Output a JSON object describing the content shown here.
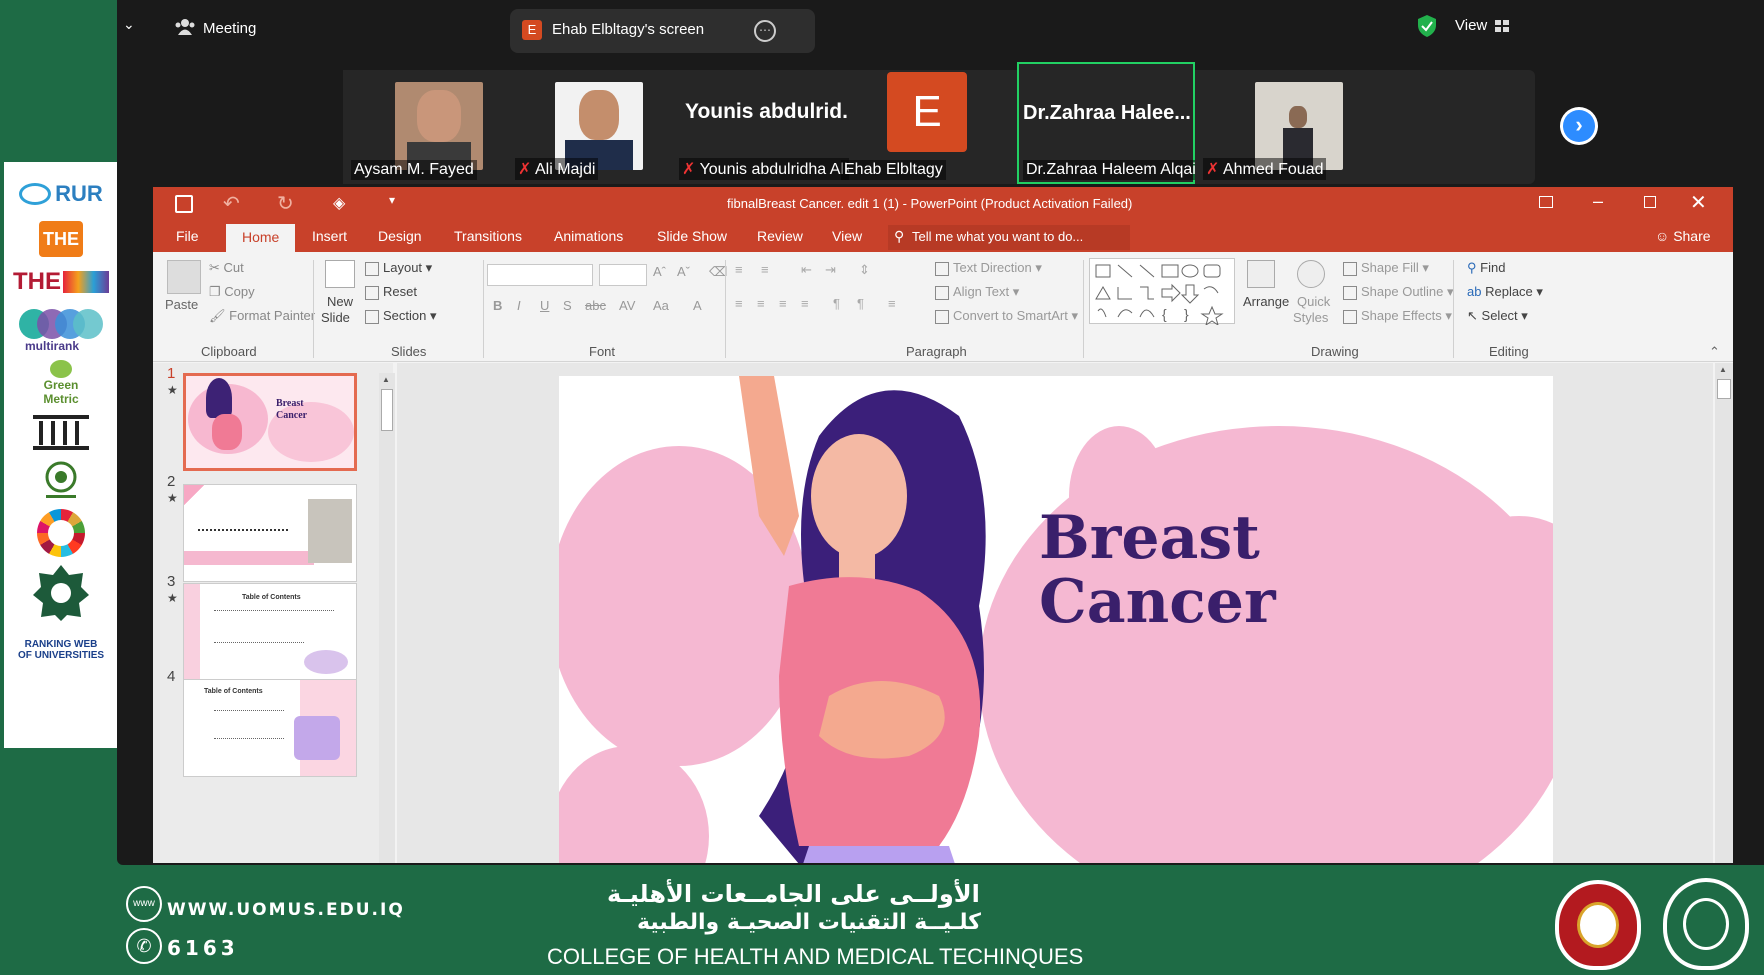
{
  "zoom": {
    "meeting_label": "Meeting",
    "screen_tab_label": "Ehab Elbltagy's screen",
    "screen_tab_initial": "E",
    "view_label": "View",
    "participants": [
      {
        "name": "Aysam  M. Fayed",
        "muted": false
      },
      {
        "name": "Ali Majdi",
        "muted": true
      },
      {
        "name": "Younis abdulridha Alk...",
        "display": "Younis abdulrid...",
        "muted": true
      },
      {
        "name": "Ehab Elbltagy",
        "initial": "E",
        "muted": false
      },
      {
        "name": "Dr.Zahraa Haleem Alqaim",
        "display": "Dr.Zahraa  Halee...",
        "muted": false,
        "speaking": true
      },
      {
        "name": "Ahmed Fouad",
        "muted": true
      }
    ]
  },
  "ppt": {
    "window_title": "fibnalBreast Cancer. edit 1 (1) - PowerPoint (Product Activation Failed)",
    "tabs": [
      "File",
      "Home",
      "Insert",
      "Design",
      "Transitions",
      "Animations",
      "Slide Show",
      "Review",
      "View"
    ],
    "tell_me": "Tell me what you want to do...",
    "share": "Share",
    "clipboard": {
      "paste": "Paste",
      "cut": "Cut",
      "copy": "Copy",
      "format_painter": "Format Painter",
      "group": "Clipboard"
    },
    "slides_group": {
      "new_slide_1": "New",
      "new_slide_2": "Slide",
      "layout": "Layout",
      "reset": "Reset",
      "section": "Section",
      "group": "Slides"
    },
    "font_group": "Font",
    "paragraph": {
      "text_direction": "Text Direction",
      "align_text": "Align Text",
      "convert": "Convert to SmartArt",
      "group": "Paragraph"
    },
    "drawing": {
      "arrange": "Arrange",
      "quick_1": "Quick",
      "quick_2": "Styles",
      "shape_fill": "Shape Fill",
      "shape_outline": "Shape Outline",
      "shape_effects": "Shape Effects",
      "group": "Drawing"
    },
    "editing": {
      "find": "Find",
      "replace": "Replace",
      "select": "Select",
      "group": "Editing"
    },
    "slide_numbers": [
      "1",
      "2",
      "3",
      "4"
    ],
    "thumb1_title_1": "Breast",
    "thumb1_title_2": "Cancer",
    "thumb3_title": "Table of Contents",
    "thumb4_title": "Table of Contents",
    "slide_title_1": "Breast",
    "slide_title_2": "Cancer"
  },
  "footer": {
    "website": "WWW.UOMUS.EDU.IQ",
    "phone": "6163",
    "arabic_1": "الأولــى على الجامــعات الأهليـة",
    "arabic_2": "كلـيــة التقنيات الصحيـة والطبية",
    "college": "COLLEGE OF HEALTH AND MEDICAL  TECHINQUES"
  },
  "logos": {
    "rur": "RUR",
    "the": "THE",
    "the2": "THE",
    "multirank": "multirank",
    "green_1": "Green",
    "green_2": "Metric",
    "webo_1": "RANKING WEB",
    "webo_2": "OF UNIVERSITIES"
  },
  "colors": {
    "zoom_bg": "#1a1a1a",
    "ppt_accent": "#c8412a",
    "frame_green": "#1e6b45",
    "slide_title": "#3a1f6b",
    "pink": "#f5b8d2"
  }
}
